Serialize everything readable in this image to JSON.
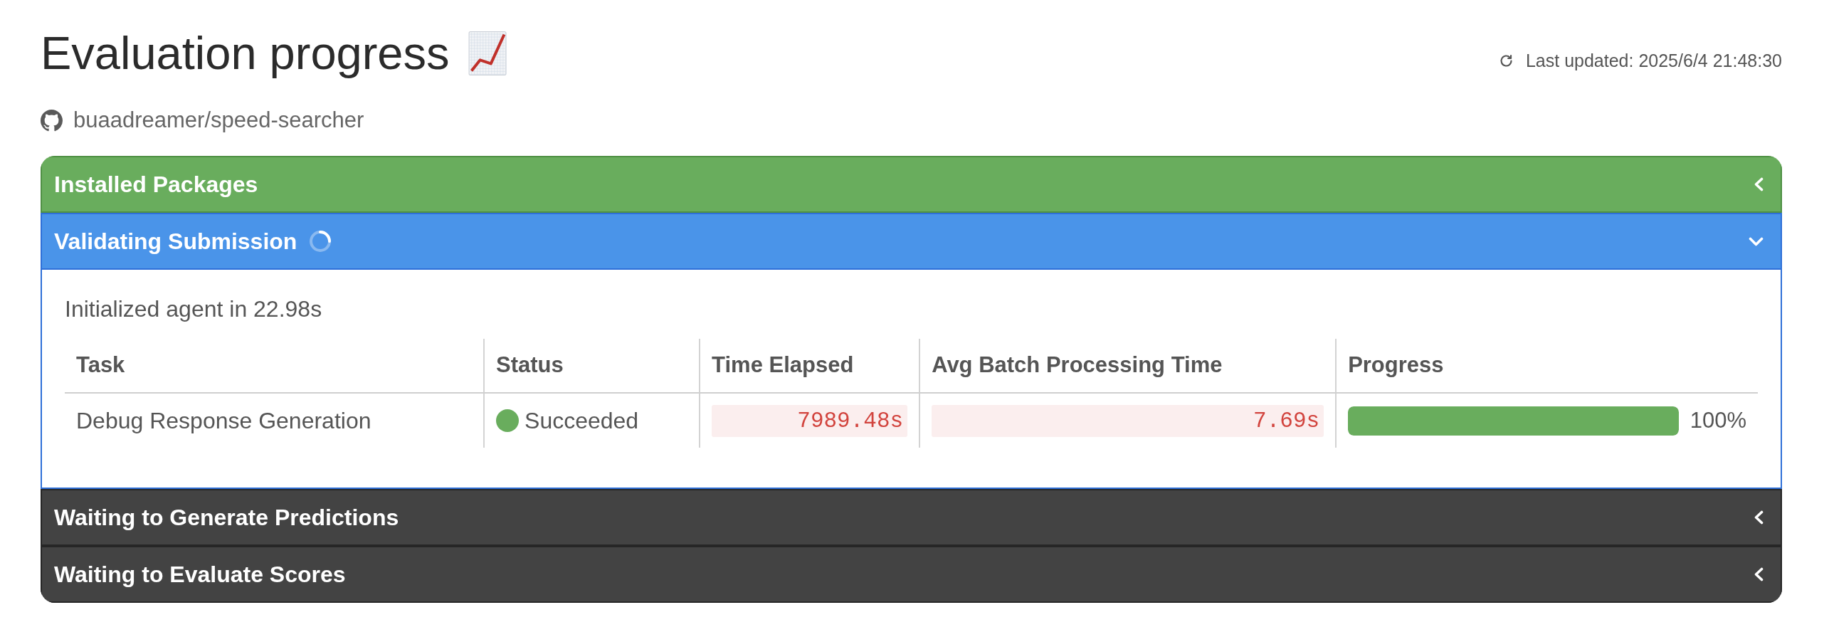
{
  "header": {
    "title": "Evaluation progress",
    "repository": "buaadreamer/speed-searcher",
    "last_updated": "Last updated: 2025/6/4 21:48:30"
  },
  "stages": [
    {
      "title": "Installed Packages",
      "kind": "success",
      "expanded": false,
      "busy": false
    },
    {
      "title": "Validating Submission",
      "kind": "running",
      "expanded": true,
      "busy": true,
      "body": {
        "message": "Initialized agent in 22.98s",
        "table": {
          "columns": [
            "Task",
            "Status",
            "Time Elapsed",
            "Avg Batch Processing Time",
            "Progress"
          ],
          "rows": [
            {
              "task": "Debug Response Generation",
              "status": {
                "text": "Succeeded",
                "color": "#69ad5d"
              },
              "time_elapsed": "7989.48s",
              "avg_batch_processing_time": "7.69s",
              "progress": {
                "level": 1,
                "reading": "100%"
              }
            }
          ]
        }
      }
    },
    {
      "title": "Waiting to Generate Predictions",
      "kind": "waiting",
      "expanded": false,
      "busy": false
    },
    {
      "title": "Waiting to Evaluate Scores",
      "kind": "waiting",
      "expanded": false,
      "busy": false
    }
  ]
}
